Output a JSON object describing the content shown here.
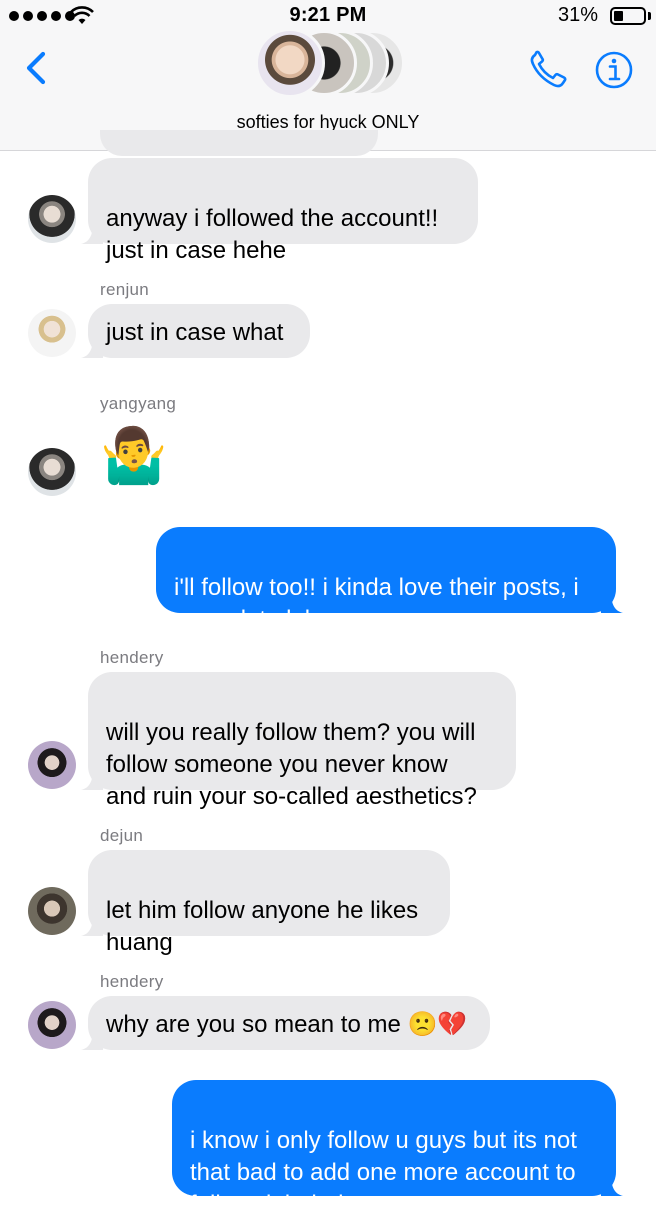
{
  "status_bar": {
    "time": "9:21 PM",
    "battery_percent": "31%",
    "battery_level": 0.31,
    "signal_dots": 5
  },
  "header": {
    "group_name": "softies for hyuck ONLY",
    "back_icon": "chevron-left-icon",
    "call_icon": "phone-icon",
    "info_icon": "info-icon"
  },
  "colors": {
    "accent": "#0a7cfe",
    "incoming_bubble": "#e9e9eb",
    "sender_name": "#7b7b80"
  },
  "messages": [
    {
      "direction": "in",
      "text": "anyway i followed the account!!\njust in case hehe"
    },
    {
      "direction": "in",
      "sender": "renjun",
      "text": "just in case what"
    },
    {
      "direction": "in",
      "sender": "yangyang",
      "text": "🤷‍♂️"
    },
    {
      "direction": "out",
      "text": "i'll follow too!! i kinda love their posts, i\ncan relate lol"
    },
    {
      "direction": "in",
      "sender": "hendery",
      "text": "will you really follow them? you will\nfollow someone you never know\nand ruin your so-called aesthetics?"
    },
    {
      "direction": "in",
      "sender": "dejun",
      "text": "let him follow anyone he likes\nhuang"
    },
    {
      "direction": "in",
      "sender": "hendery",
      "text": "why are you so mean to me 🙁💔"
    },
    {
      "direction": "out",
      "text": "i know i only follow u guys but its not\nthat bad to add one more account to\nfollow right hehe"
    }
  ]
}
